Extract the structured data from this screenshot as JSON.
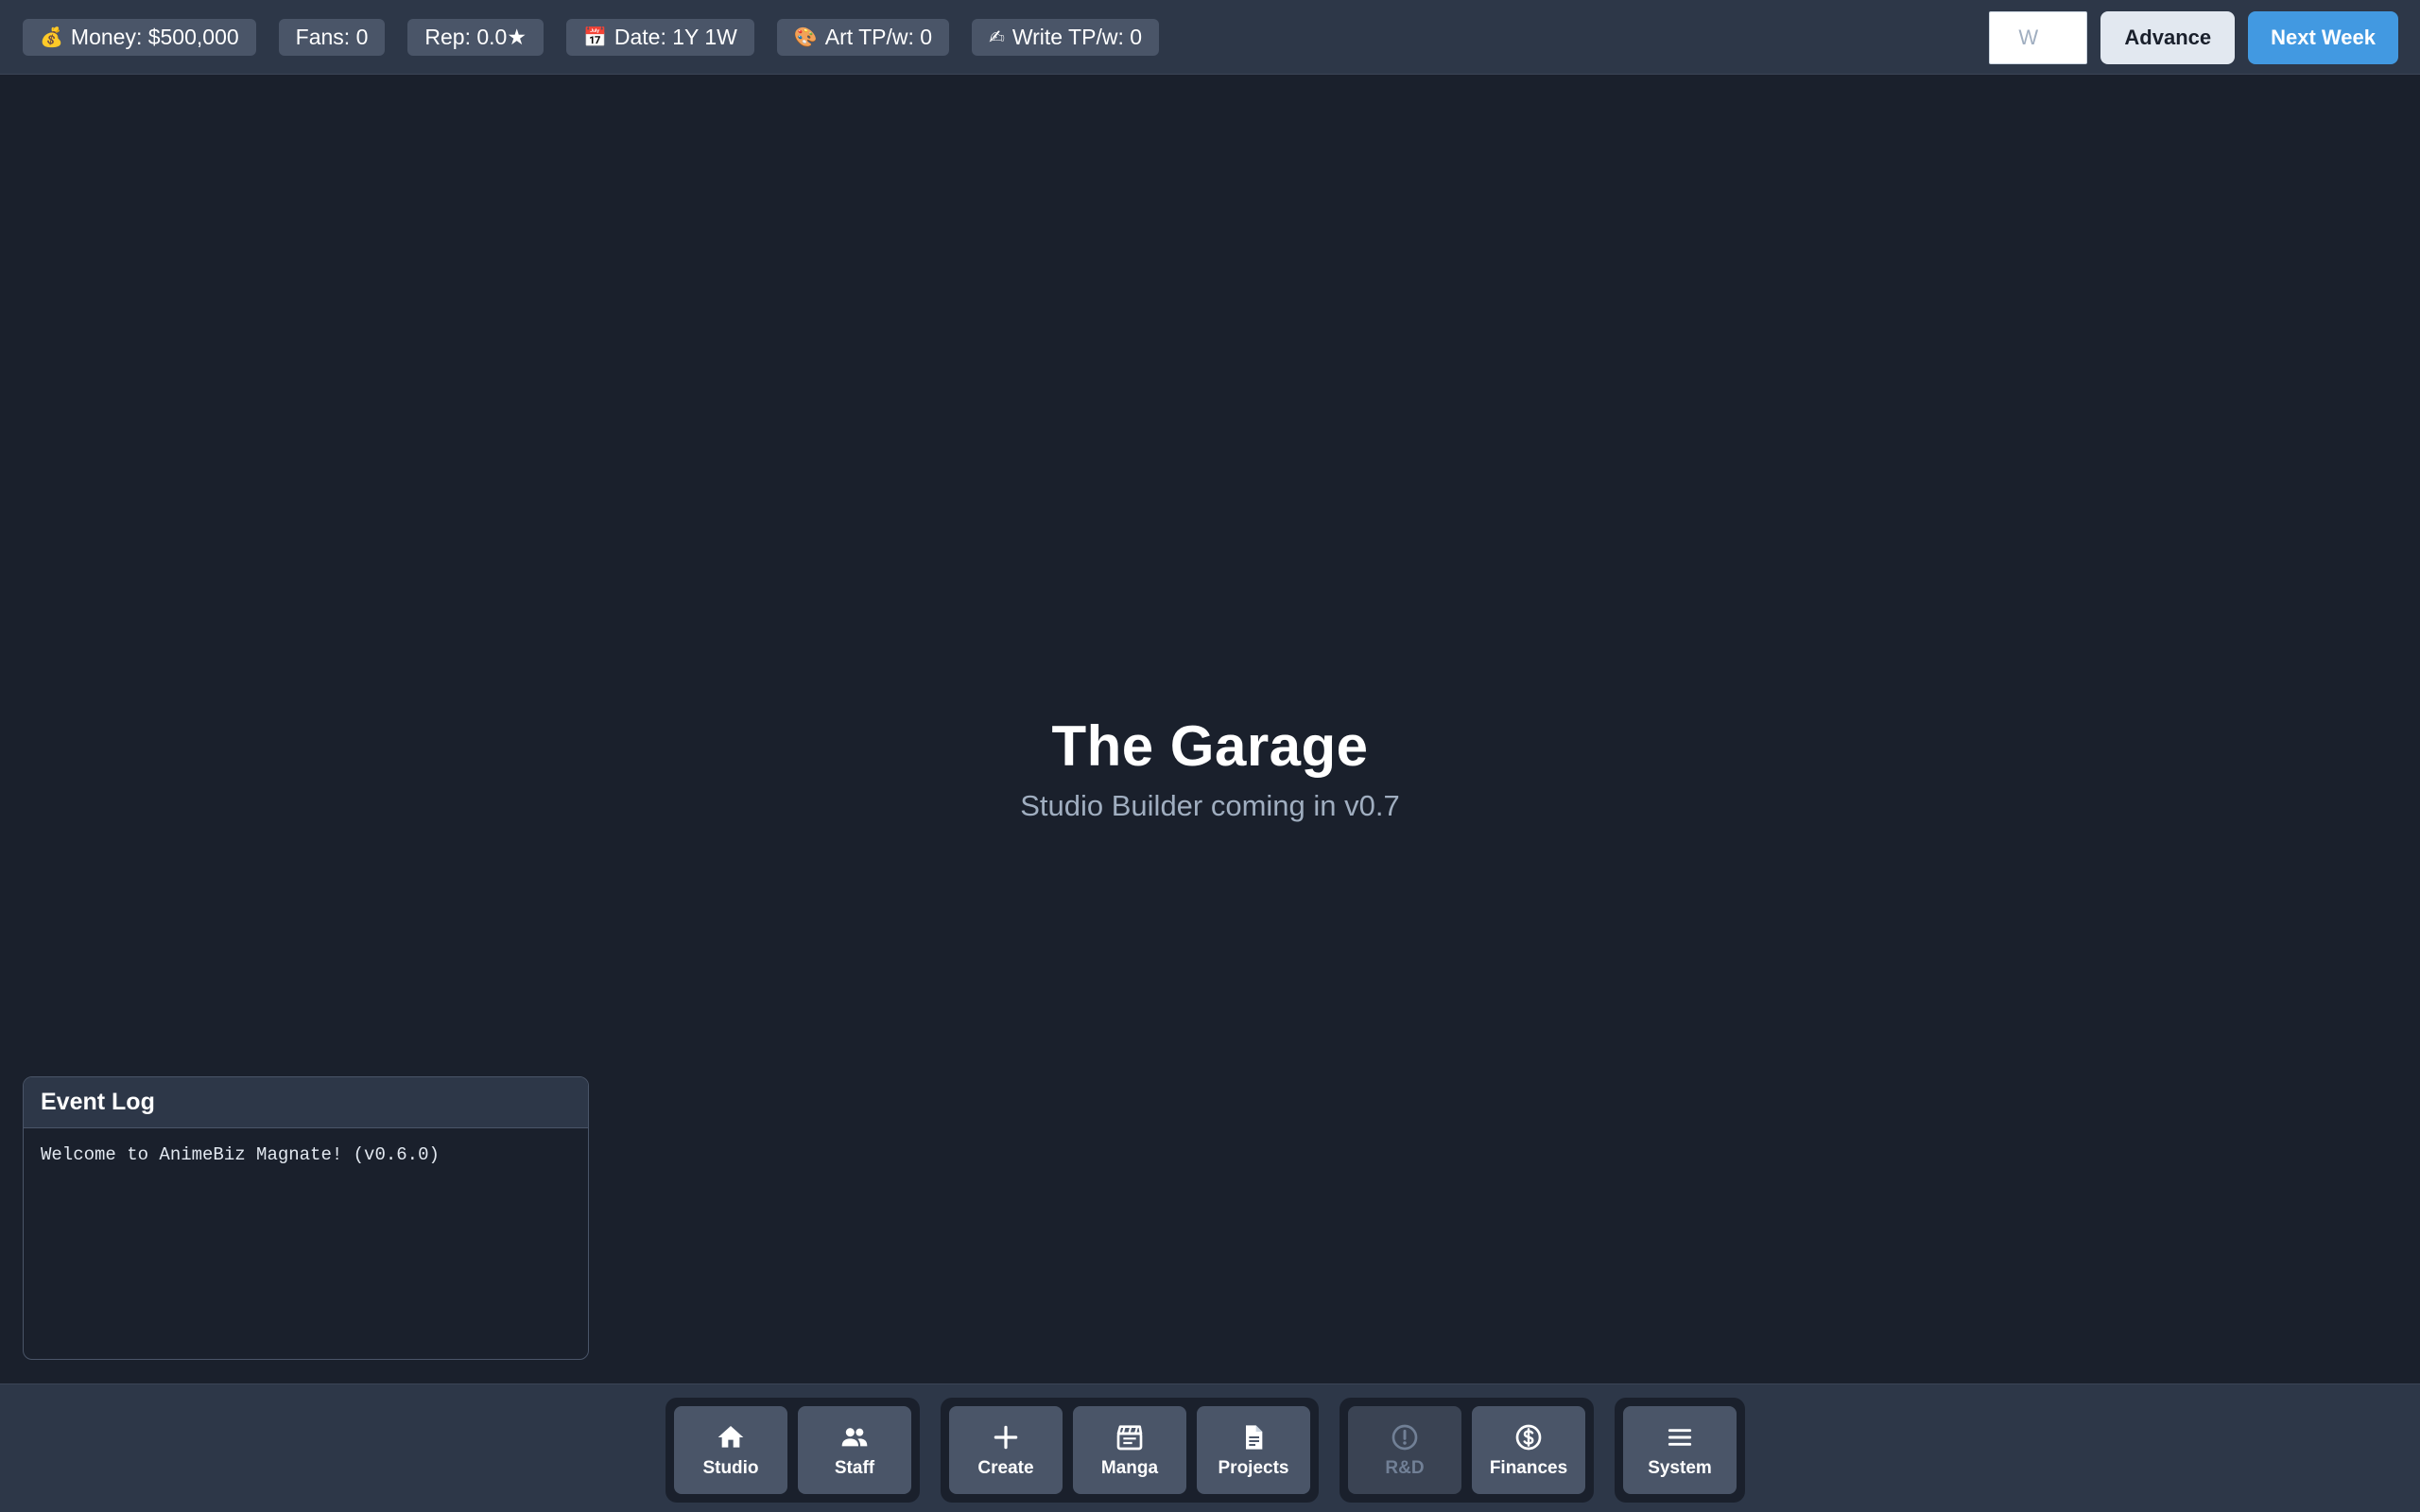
{
  "stats": {
    "money": "Money: $500,000",
    "fans": "Fans: 0",
    "rep": "Rep: 0.0★",
    "date": "Date: 1Y 1W",
    "art": "Art TP/w: 0",
    "write": "Write TP/w: 0"
  },
  "stat_icons": {
    "money": "💰",
    "date": "📅",
    "art": "🎨",
    "write": "✍"
  },
  "controls": {
    "weeks_placeholder": "W",
    "advance_label": "Advance",
    "next_week_label": "Next Week"
  },
  "main": {
    "title": "The Garage",
    "subtitle": "Studio Builder coming in v0.7"
  },
  "event_log": {
    "title": "Event Log",
    "entries": [
      "Welcome to AnimeBiz Magnate! (v0.6.0)"
    ]
  },
  "nav": {
    "studio": "Studio",
    "staff": "Staff",
    "create": "Create",
    "manga": "Manga",
    "projects": "Projects",
    "rnd": "R&D",
    "finances": "Finances",
    "system": "System"
  },
  "colors": {
    "background": "#1a202c",
    "bar": "#2d3748",
    "chip": "#4a5568",
    "accent": "#4299e1"
  }
}
